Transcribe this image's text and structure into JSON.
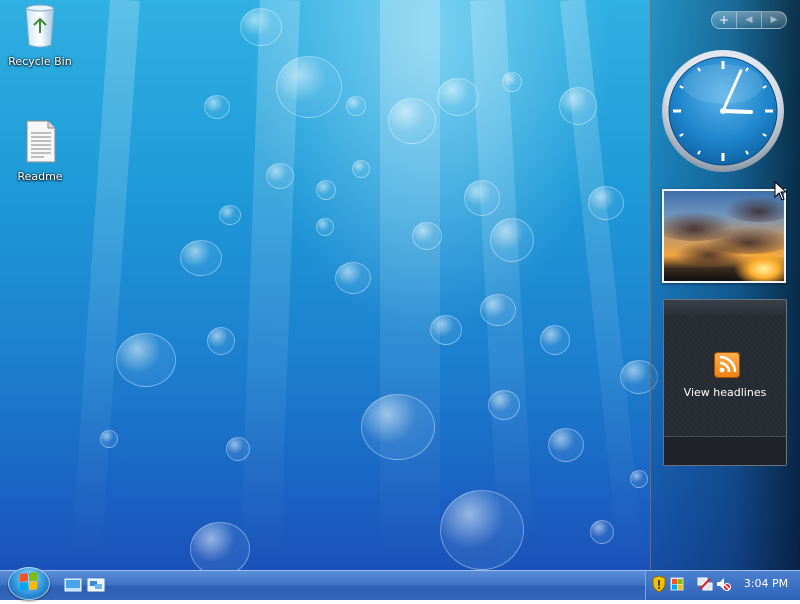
{
  "desktop": {
    "icons": [
      {
        "label": "Recycle Bin",
        "icon": "recycle-bin-icon"
      },
      {
        "label": "Readme",
        "icon": "text-document-icon"
      }
    ]
  },
  "sidebar": {
    "controls": {
      "add_label": "+",
      "prev_label": "◀",
      "next_label": "▶"
    },
    "clock_gadget": {
      "hour": 3,
      "minute": 4
    },
    "slideshow_gadget": {
      "image": "sunset-clouds"
    },
    "feed_gadget": {
      "label": "View headlines",
      "icon": "rss-icon"
    }
  },
  "taskbar": {
    "start_icon": "windows-logo-icon",
    "quick_launch": [
      "show-desktop-icon",
      "switch-windows-icon"
    ],
    "tray_icons": [
      "security-shield-icon",
      "windows-flag-icon",
      "network-icon",
      "volume-muted-icon"
    ],
    "clock": "3:04 PM"
  },
  "colors": {
    "desktop_top": "#2fb0e2",
    "desktop_bottom": "#1b4bb4",
    "taskbar": "#3e73c6",
    "rss_orange": "#f08010"
  }
}
